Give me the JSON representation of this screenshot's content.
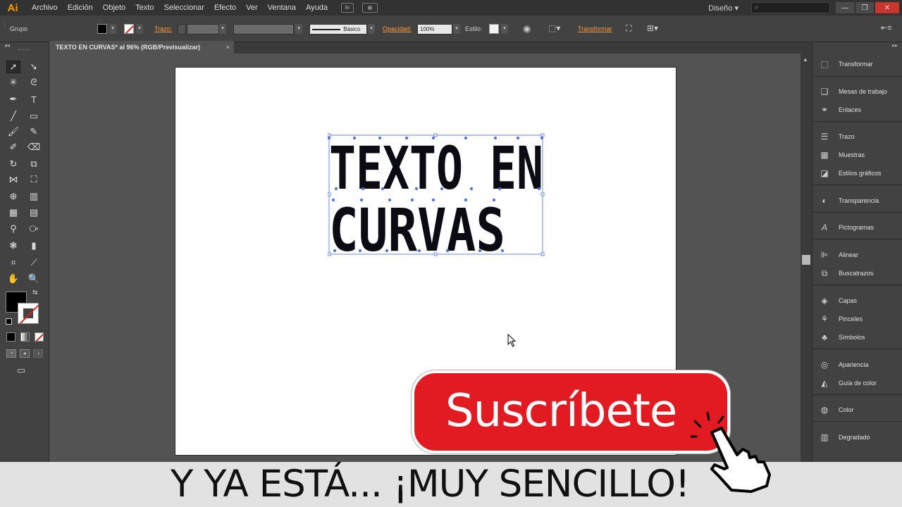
{
  "app": {
    "logo": "Ai"
  },
  "menu": {
    "items": [
      "Archivo",
      "Edición",
      "Objeto",
      "Texto",
      "Seleccionar",
      "Efecto",
      "Ver",
      "Ventana",
      "Ayuda"
    ],
    "bridge": "Br"
  },
  "workspace": {
    "label": "Diseño",
    "search_icon": "search-icon"
  },
  "controlbar": {
    "selection_label": "Grupo",
    "stroke_label": "Trazo:",
    "stroke_style": "Básico",
    "opacity_label": "Opacidad:",
    "opacity_value": "100%",
    "style_label": "Estilo:",
    "transform_label": "Transformar",
    "fill_color": "#000000",
    "accent_color": "#ff9a3c"
  },
  "document": {
    "tab_title": "TEXTO EN CURVAS* al 96% (RGB/Previsualizar)",
    "close": "×"
  },
  "artwork": {
    "line1": "TEXTO EN",
    "line2": "CURVAS",
    "selection_color": "#4a6fd8"
  },
  "panels": {
    "items": [
      {
        "label": "Transformar",
        "icon": "transform-icon"
      },
      {
        "label": "Mesas de trabajo",
        "icon": "artboards-icon"
      },
      {
        "label": "Enlaces",
        "icon": "links-icon"
      },
      {
        "label": "Trazo",
        "icon": "stroke-icon"
      },
      {
        "label": "Muestras",
        "icon": "swatches-icon"
      },
      {
        "label": "Estilos gráficos",
        "icon": "graphic-styles-icon"
      },
      {
        "label": "Transparencia",
        "icon": "transparency-icon"
      },
      {
        "label": "Pictogramas",
        "icon": "glyphs-icon"
      },
      {
        "label": "Alinear",
        "icon": "align-icon"
      },
      {
        "label": "Buscatrazos",
        "icon": "pathfinder-icon"
      },
      {
        "label": "Capas",
        "icon": "layers-icon"
      },
      {
        "label": "Pinceles",
        "icon": "brushes-icon"
      },
      {
        "label": "Símbolos",
        "icon": "symbols-icon"
      },
      {
        "label": "Apariencia",
        "icon": "appearance-icon"
      },
      {
        "label": "Guía de color",
        "icon": "color-guide-icon"
      },
      {
        "label": "Color",
        "icon": "color-icon"
      },
      {
        "label": "Degradado",
        "icon": "gradient-icon"
      }
    ]
  },
  "overlay": {
    "subscribe_label": "Suscríbete",
    "caption": "Y YA ESTÁ... ¡MUY SENCILLO!",
    "subscribe_color": "#e21b23"
  }
}
